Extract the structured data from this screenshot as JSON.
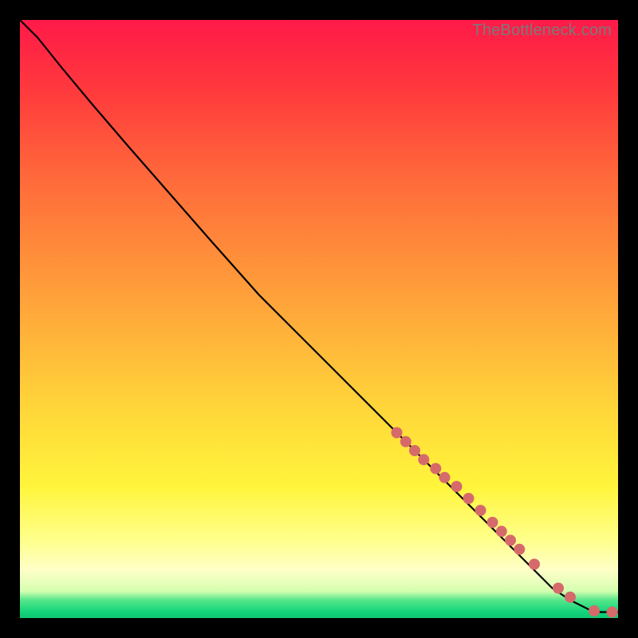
{
  "watermark": "TheBottleneck.com",
  "chart_data": {
    "type": "line",
    "title": "",
    "xlabel": "",
    "ylabel": "",
    "xlim": [
      0,
      100
    ],
    "ylim": [
      0,
      100
    ],
    "grid": false,
    "series": [
      {
        "name": "curve",
        "x": [
          0,
          3,
          7,
          12,
          18,
          25,
          32,
          40,
          48,
          55,
          62,
          68,
          74,
          80,
          85,
          89,
          92,
          95,
          97,
          100
        ],
        "y": [
          100,
          97,
          92,
          86,
          79,
          71,
          63,
          54,
          46,
          39,
          32,
          26,
          20,
          14,
          9,
          5,
          3,
          1.5,
          1,
          1
        ]
      }
    ],
    "markers": {
      "name": "highlighted-points",
      "color": "#d66a6a",
      "radius_px": 7,
      "x": [
        63,
        64.5,
        66,
        67.5,
        69.5,
        71,
        73,
        75,
        77,
        79,
        80.5,
        82,
        83.5,
        86,
        90,
        92,
        96,
        99
      ],
      "y": [
        31,
        29.5,
        28,
        26.5,
        25,
        23.5,
        22,
        20,
        18,
        16,
        14.5,
        13,
        11.5,
        9,
        5,
        3.5,
        1.2,
        1
      ]
    }
  }
}
